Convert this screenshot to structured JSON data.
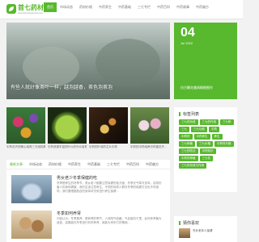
{
  "brand": {
    "name": "首七药材网",
    "tagline": "www.shouqiyaocai.com",
    "accent": "#58b82e"
  },
  "nav": [
    {
      "label": "首页",
      "active": true
    },
    {
      "label": "市场动态"
    },
    {
      "label": "药材价格"
    },
    {
      "label": "中药养生"
    },
    {
      "label": "中药基础"
    },
    {
      "label": "三七专栏"
    },
    {
      "label": "中药百科"
    },
    {
      "label": "中药故事"
    },
    {
      "label": "中药偏方"
    }
  ],
  "hero": {
    "caption": "有些人就好像茶叶一样，越泡越香，茶色泡茶泡"
  },
  "date": {
    "day": "04",
    "month": "Jul 2022",
    "text": "仿古雕花兼具精细细作"
  },
  "tiles": [
    {
      "label": "中药花卉的精心培育三叉线钩尾草…"
    },
    {
      "label": "中药资源丰富的叶片的叶片培育"
    },
    {
      "label": "中药的叶芽的芯片中药"
    },
    {
      "label": "中药的中药培养中药香花卉…"
    }
  ],
  "tabs": [
    {
      "label": "最新文章",
      "active": true
    },
    {
      "label": "市场动态"
    },
    {
      "label": "药材价格"
    },
    {
      "label": "中药养生"
    },
    {
      "label": "中药基础"
    },
    {
      "label": "三七专栏"
    },
    {
      "label": "中药百科"
    },
    {
      "label": "中药偏方"
    }
  ],
  "articles": [
    {
      "title": "男女老少冬季保健的吃",
      "text": "冬季是养生的好季节，男女老少都要注意保健的各方面，冬季天气寒冷多风，容易伤害人的身体健康，我们应该注意养生。不同的体质人群在冬季的保健方法也不尽相同，我们要根据各自的身体状况来进行养生保健…"
    },
    {
      "title": "冬季如何养肾",
      "text": "中医认为，冬季属肾，是养肾的季节，人体阳气收藏，气血趋向于里，此时养肾最为适宜，如果能在冬季进行科学养肾，就能为来年打好基础…"
    }
  ],
  "sidebar": {
    "tags_title": "标签列表",
    "tags": [
      "三七的功效",
      "三七的作用",
      "三七粉",
      "三七",
      "三七功效",
      "中药",
      "中药材",
      "中药养生",
      "养生",
      "三七种植",
      "三七价格",
      "中药材价格",
      "三七的吃法",
      "中药知识",
      "中药材种植",
      "三七花",
      "三七的功效与作用"
    ],
    "rec_title": "猜你喜欢",
    "rec_item": "冬补老年人保健"
  }
}
